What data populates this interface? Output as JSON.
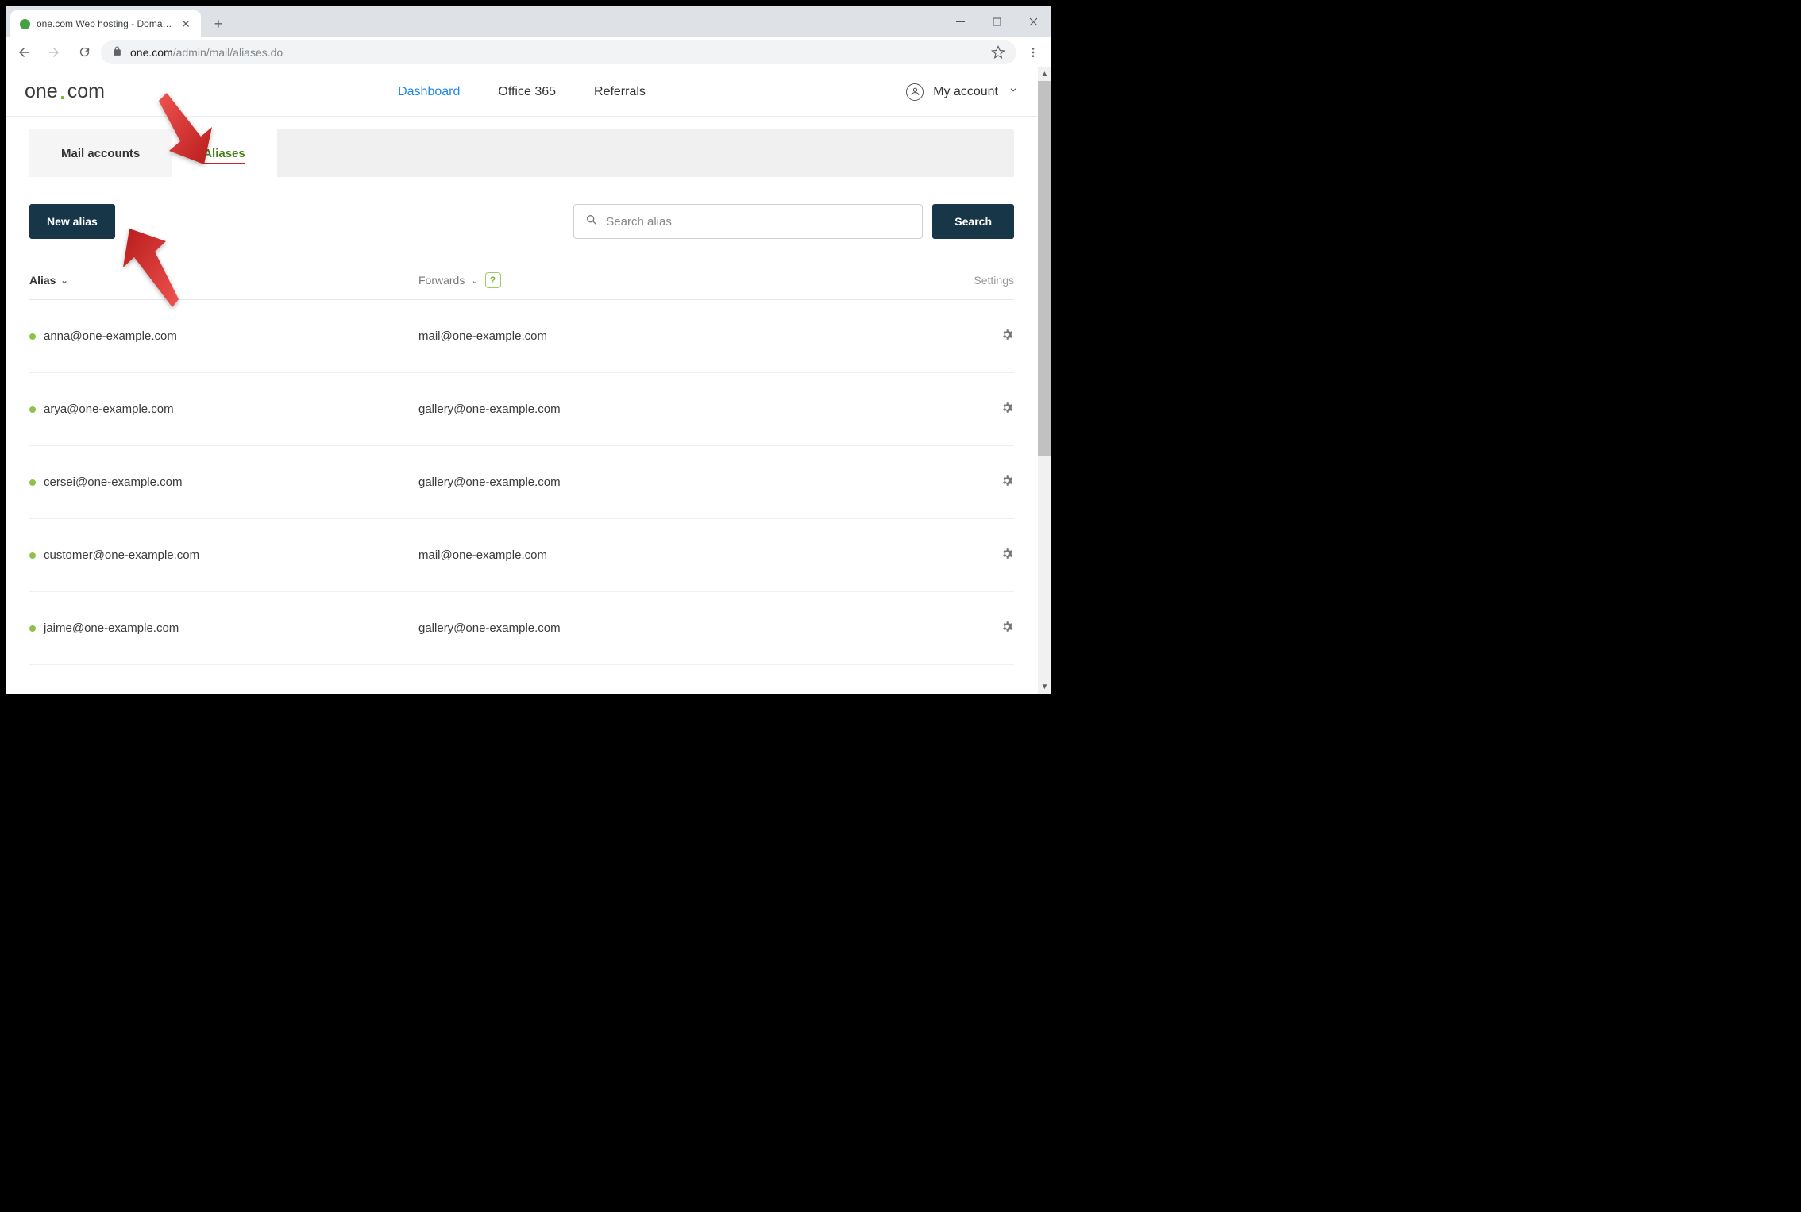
{
  "browser": {
    "tab_title": "one.com Web hosting  -  Domain…",
    "url_host": "one.com",
    "url_path": "/admin/mail/aliases.do"
  },
  "logo": {
    "part1": "one",
    "part2": "com"
  },
  "nav": {
    "dashboard": "Dashboard",
    "office365": "Office 365",
    "referrals": "Referrals",
    "my_account": "My account"
  },
  "tabs": {
    "mail_accounts": "Mail accounts",
    "aliases": "Aliases"
  },
  "actions": {
    "new_alias": "New alias",
    "search_btn": "Search",
    "search_placeholder": "Search alias"
  },
  "columns": {
    "alias": "Alias",
    "forwards": "Forwards",
    "settings": "Settings",
    "help": "?"
  },
  "rows": [
    {
      "alias": "anna@one-example.com",
      "forwards": "mail@one-example.com"
    },
    {
      "alias": "arya@one-example.com",
      "forwards": "gallery@one-example.com"
    },
    {
      "alias": "cersei@one-example.com",
      "forwards": "gallery@one-example.com"
    },
    {
      "alias": "customer@one-example.com",
      "forwards": "mail@one-example.com"
    },
    {
      "alias": "jaime@one-example.com",
      "forwards": "gallery@one-example.com"
    }
  ]
}
